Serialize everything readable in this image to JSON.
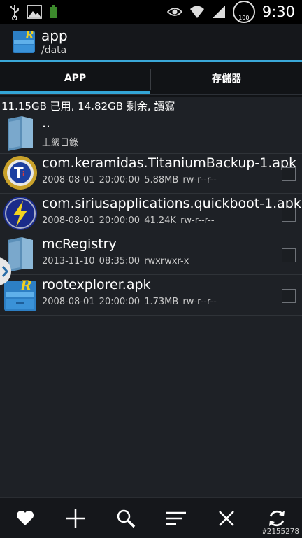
{
  "status_bar": {
    "time": "9:30",
    "battery_level": "100"
  },
  "app": {
    "title": "app",
    "path": "/data"
  },
  "tabs": [
    {
      "label": "APP"
    },
    {
      "label": "存儲器"
    }
  ],
  "usage_text": "11.15GB 已用, 14.82GB 剩余, 讀寫",
  "files": [
    {
      "name": "..",
      "meta": "上級目錄",
      "icon": "folder-icon",
      "checkbox": false
    },
    {
      "name": "com.keramidas.TitaniumBackup-1.apk",
      "meta": "2008-08-01 20:00:00  5.88MB  rw-r--r--",
      "icon": "titanium-backup-icon",
      "checkbox": true
    },
    {
      "name": "com.siriusapplications.quickboot-1.apk",
      "meta": "2008-08-01 20:00:00  41.24K  rw-r--r--",
      "icon": "quickboot-icon",
      "checkbox": true
    },
    {
      "name": "mcRegistry",
      "meta": "2013-11-10 08:35:00     rwxrwxr-x",
      "icon": "folder-icon",
      "checkbox": true
    },
    {
      "name": "rootexplorer.apk",
      "meta": "2008-08-01 20:00:00  1.73MB  rw-r--r--",
      "icon": "root-explorer-icon",
      "checkbox": true
    }
  ],
  "bottom_actions": [
    {
      "icon": "heart-icon"
    },
    {
      "icon": "plus-icon"
    },
    {
      "icon": "search-icon"
    },
    {
      "icon": "sort-icon"
    },
    {
      "icon": "close-icon"
    },
    {
      "icon": "refresh-icon"
    }
  ],
  "watermark": "#2155278",
  "colors": {
    "accent": "#33a5d6",
    "background": "#1e2126"
  }
}
